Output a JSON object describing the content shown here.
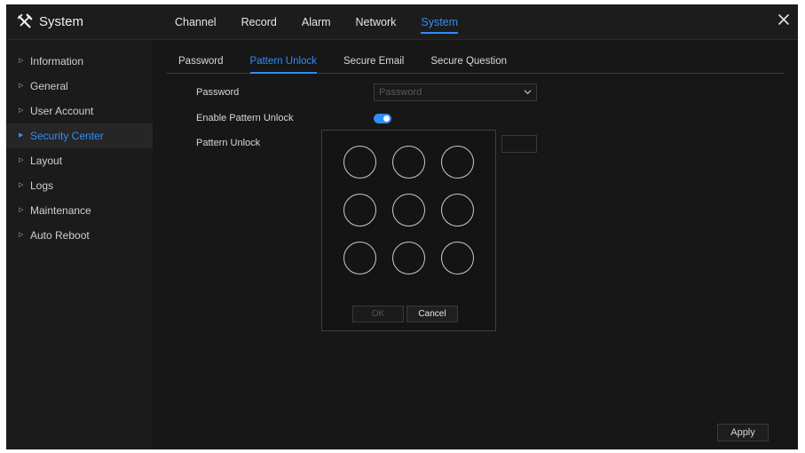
{
  "app": {
    "title": "System"
  },
  "top_tabs": [
    {
      "label": "Channel",
      "active": false
    },
    {
      "label": "Record",
      "active": false
    },
    {
      "label": "Alarm",
      "active": false
    },
    {
      "label": "Network",
      "active": false
    },
    {
      "label": "System",
      "active": true
    }
  ],
  "sidebar": {
    "items": [
      {
        "label": "Information",
        "active": false
      },
      {
        "label": "General",
        "active": false
      },
      {
        "label": "User Account",
        "active": false
      },
      {
        "label": "Security Center",
        "active": true
      },
      {
        "label": "Layout",
        "active": false
      },
      {
        "label": "Logs",
        "active": false
      },
      {
        "label": "Maintenance",
        "active": false
      },
      {
        "label": "Auto Reboot",
        "active": false
      }
    ]
  },
  "sub_tabs": [
    {
      "label": "Password",
      "active": false
    },
    {
      "label": "Pattern Unlock",
      "active": true
    },
    {
      "label": "Secure Email",
      "active": false
    },
    {
      "label": "Secure Question",
      "active": false
    }
  ],
  "form": {
    "password_label": "Password",
    "password_placeholder": "Password",
    "enable_label": "Enable Pattern Unlock",
    "enable_on": true,
    "pattern_label": "Pattern Unlock"
  },
  "dialog": {
    "ok_label": "OK",
    "cancel_label": "Cancel",
    "dot_count": 9
  },
  "footer": {
    "apply_label": "Apply"
  },
  "colors": {
    "accent": "#2f8df5",
    "background": "#171717",
    "sidebar": "#1b1b1b"
  },
  "icons": {
    "app": "tools-icon",
    "close": "close-icon",
    "select": "chevron-down-icon",
    "nav": "triangle-right-icon"
  }
}
